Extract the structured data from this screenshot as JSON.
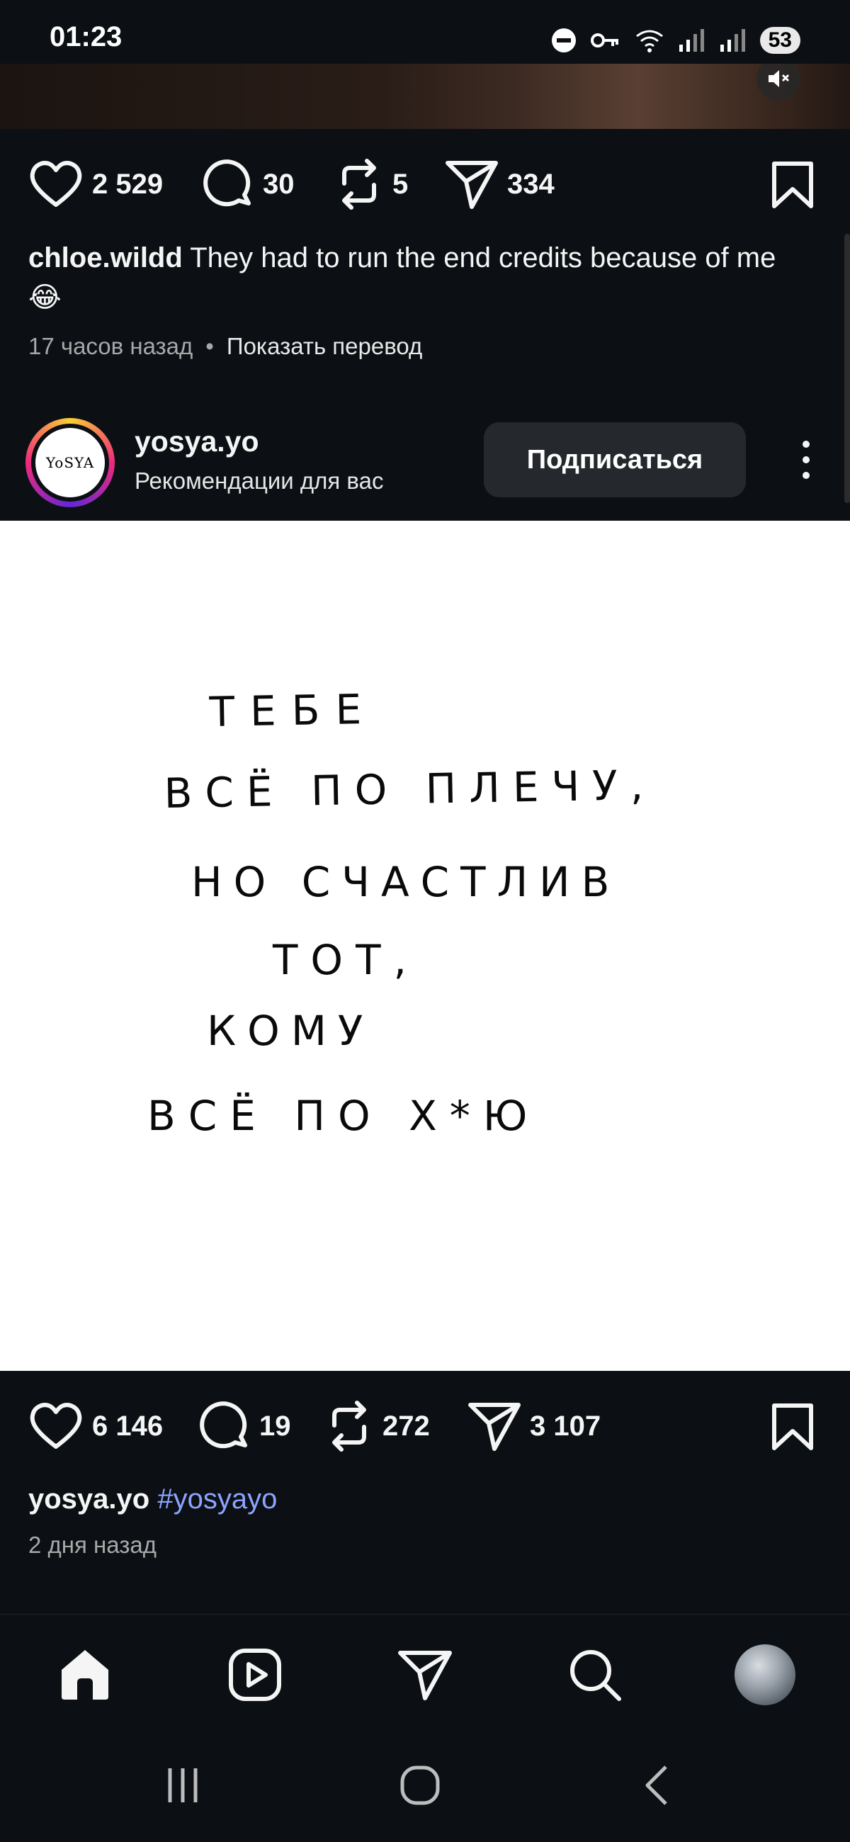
{
  "status_bar": {
    "time": "01:23",
    "battery": "53"
  },
  "prev_post": {
    "likes": "2 529",
    "comments": "30",
    "reposts": "5",
    "shares": "334",
    "caption_user": "chloe.wildd",
    "caption_text": "They had to run the end credits because of me",
    "caption_emoji": "😂",
    "time_ago": "17 часов назад",
    "translate_label": "Показать перевод"
  },
  "post": {
    "username": "yosya.yo",
    "subtitle": "Рекомендации для вас",
    "follow_label": "Подписаться",
    "avatar_text": "YoSYA",
    "image_lines": [
      "ТЕБЕ",
      "ВСЁ ПО ПЛЕЧУ,",
      "НО СЧАСТЛИВ",
      "ТОТ,",
      "КОМУ",
      "ВСЁ ПО Х*Ю"
    ],
    "likes": "6 146",
    "comments": "19",
    "reposts": "272",
    "shares": "3 107",
    "caption_user": "yosya.yo",
    "hashtag": "#yosyayo",
    "time_ago": "2 дня назад"
  },
  "colors": {
    "background": "#0c1014",
    "link": "#8da4ff",
    "button": "#25292e"
  }
}
